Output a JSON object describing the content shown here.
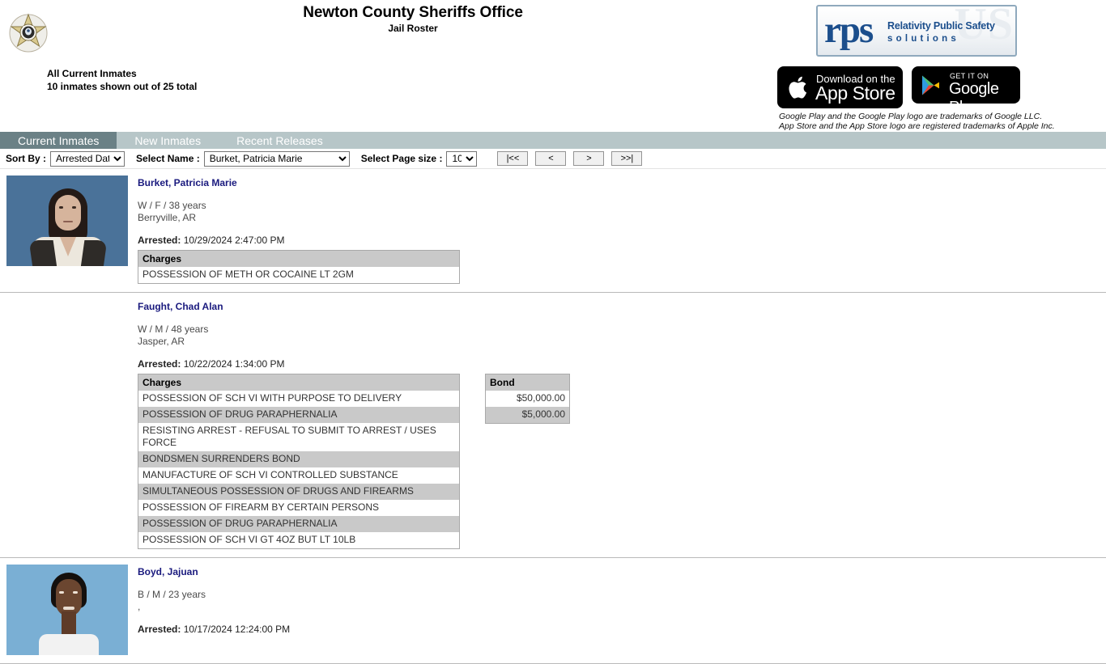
{
  "header": {
    "badge_icon": "sheriff-star-badge-icon",
    "title": "Newton County Sheriffs Office",
    "subtitle": "Jail Roster",
    "summary_line1": "All Current Inmates",
    "summary_line2": "10 inmates shown out of 25 total"
  },
  "branding": {
    "rps_mark": "rps",
    "rps_ghost": "US",
    "rps_line1": "Relativity Public Safety",
    "rps_line2": "solutions",
    "apple_badge": {
      "small": "Download on the",
      "large": "App Store",
      "icon": "apple-logo-icon"
    },
    "google_badge": {
      "small": "GET IT ON",
      "large": "Google Play",
      "icon": "google-play-logo-icon"
    },
    "trademark_line1": "Google Play and the Google Play logo are trademarks of Google LLC.",
    "trademark_line2": "App Store and the App Store logo are registered trademarks of Apple Inc.",
    "accent_blue": "#1b4e8c"
  },
  "tabs": [
    {
      "label": "Current Inmates",
      "active": true
    },
    {
      "label": "New Inmates",
      "active": false
    },
    {
      "label": "Recent Releases",
      "active": false
    }
  ],
  "controls": {
    "sort_label": "Sort By :",
    "sort_value": "Arrested Date",
    "sort_options": [
      "Arrested Date"
    ],
    "name_label": "Select Name :",
    "name_value": "Burket, Patricia Marie",
    "name_options": [
      "Burket, Patricia Marie"
    ],
    "pagesize_label": "Select Page size :",
    "pagesize_value": "10",
    "pagesize_options": [
      "10"
    ],
    "pager": {
      "first": "|<<",
      "prev": "<",
      "next": ">",
      "last": ">>|"
    }
  },
  "table_headers": {
    "charges": "Charges",
    "bond": "Bond"
  },
  "inmates": [
    {
      "name": "Burket, Patricia Marie",
      "demographics": "W / F / 38 years",
      "location": "Berryville, AR",
      "arrested_label": "Arrested:",
      "arrested_value": "10/29/2024 2:47:00 PM",
      "has_photo": true,
      "photo_style": "a",
      "charges": [
        "POSSESSION OF METH OR COCAINE LT 2GM"
      ],
      "bonds": []
    },
    {
      "name": "Faught, Chad Alan",
      "demographics": "W / M / 48 years",
      "location": "Jasper, AR",
      "arrested_label": "Arrested:",
      "arrested_value": "10/22/2024 1:34:00 PM",
      "has_photo": false,
      "photo_style": "",
      "charges": [
        "POSSESSION OF SCH VI WITH PURPOSE TO DELIVERY",
        "POSSESSION OF DRUG PARAPHERNALIA",
        "RESISTING ARREST - REFUSAL TO SUBMIT TO ARREST / USES FORCE",
        "BONDSMEN SURRENDERS BOND",
        "MANUFACTURE OF SCH VI CONTROLLED SUBSTANCE",
        "SIMULTANEOUS POSSESSION OF DRUGS AND FIREARMS",
        "POSSESSION OF FIREARM BY CERTAIN PERSONS",
        "POSSESSION OF DRUG PARAPHERNALIA",
        "POSSESSION OF SCH VI GT 4OZ BUT LT 10LB"
      ],
      "bonds": [
        "$50,000.00",
        "$5,000.00"
      ]
    },
    {
      "name": "Boyd, Jajuan",
      "demographics": "B / M / 23 years",
      "location": ",",
      "arrested_label": "Arrested:",
      "arrested_value": "10/17/2024 12:24:00 PM",
      "has_photo": true,
      "photo_style": "b",
      "charges": [],
      "bonds": []
    }
  ]
}
